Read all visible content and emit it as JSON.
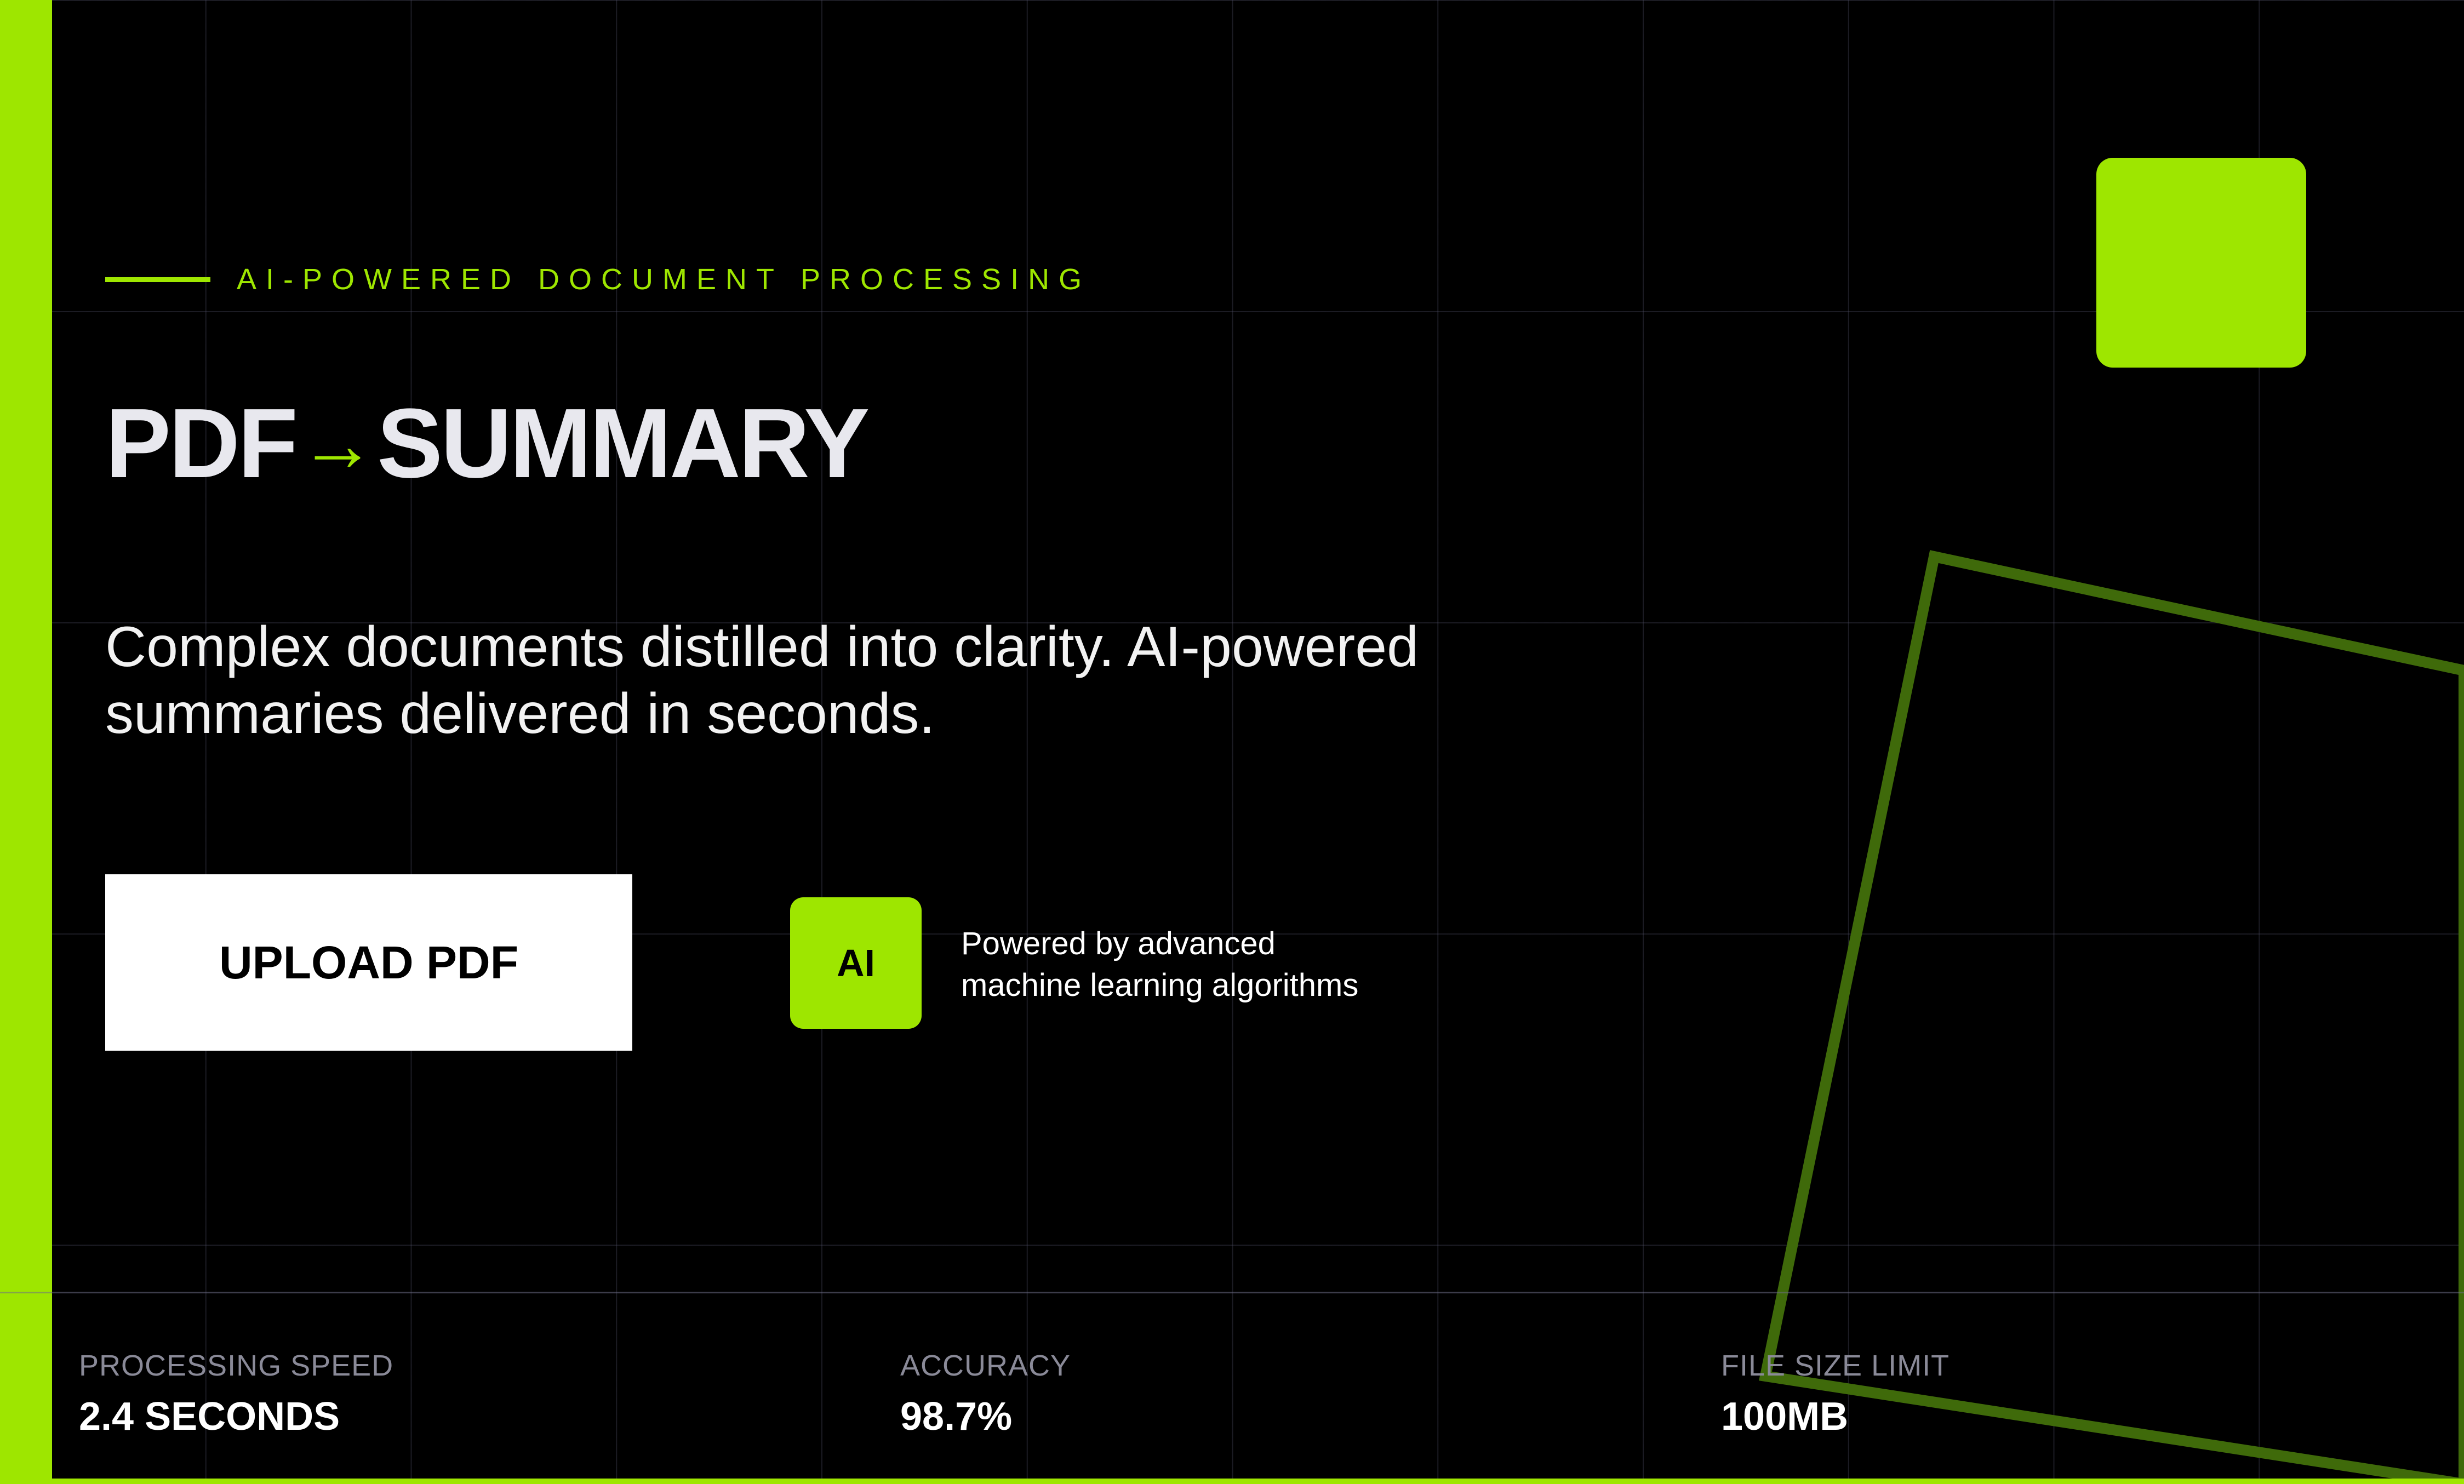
{
  "hero": {
    "eyebrow": "AI-POWERED DOCUMENT PROCESSING",
    "title_left": "PDF",
    "title_arrow": "→",
    "title_right": "SUMMARY",
    "subtitle": "Complex documents distilled into clarity. AI-powered summaries delivered in seconds."
  },
  "upload_button": {
    "label": "UPLOAD PDF"
  },
  "ai_badge": {
    "label": "AI",
    "caption_line1": "Powered by advanced",
    "caption_line2": "machine learning algorithms"
  },
  "stats": [
    {
      "label": "PROCESSING SPEED",
      "value": "2.4 SECONDS"
    },
    {
      "label": "ACCURACY",
      "value": "98.7%"
    },
    {
      "label": "FILE SIZE LIMIT",
      "value": "100MB"
    }
  ],
  "colors": {
    "accent": "#9ee600",
    "background": "#000000",
    "button_bg": "#ffffff",
    "frame_outline": "#3f6a0a"
  }
}
